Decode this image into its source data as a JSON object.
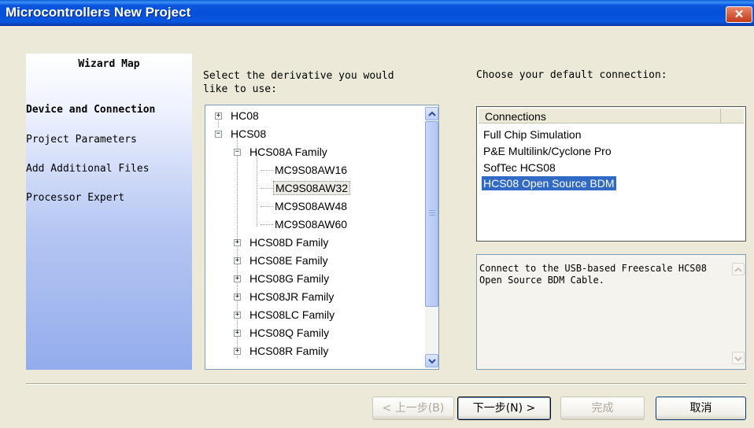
{
  "window": {
    "title": "Microcontrollers New Project",
    "close_glyph": "✕"
  },
  "wizard_map": {
    "heading": "Wizard Map",
    "steps": [
      {
        "label": "Device and Connection",
        "current": true
      },
      {
        "label": "Project Parameters",
        "current": false
      },
      {
        "label": "Add Additional Files",
        "current": false
      },
      {
        "label": "Processor Expert",
        "current": false
      }
    ]
  },
  "derivative": {
    "prompt": "Select the derivative you would\nlike to use:",
    "tree": [
      {
        "label": "HC08",
        "expander": "+"
      },
      {
        "label": "HCS08",
        "expander": "−"
      },
      {
        "label": "HCS08A Family",
        "expander": "−"
      },
      {
        "label": "MC9S08AW16"
      },
      {
        "label": "MC9S08AW32",
        "selected": true
      },
      {
        "label": "MC9S08AW48"
      },
      {
        "label": "MC9S08AW60"
      },
      {
        "label": "HCS08D Family",
        "expander": "+"
      },
      {
        "label": "HCS08E Family",
        "expander": "+"
      },
      {
        "label": "HCS08G Family",
        "expander": "+"
      },
      {
        "label": "HCS08JR Family",
        "expander": "+"
      },
      {
        "label": "HCS08LC Family",
        "expander": "+"
      },
      {
        "label": "HCS08Q Family",
        "expander": "+"
      },
      {
        "label": "HCS08R Family",
        "expander": "+"
      }
    ]
  },
  "connection": {
    "prompt": "Choose your default connection:",
    "column_header": "Connections",
    "items": [
      {
        "label": "Full Chip Simulation",
        "selected": false
      },
      {
        "label": "P&E Multilink/Cyclone Pro",
        "selected": false
      },
      {
        "label": "SofTec HCS08",
        "selected": false
      },
      {
        "label": "HCS08 Open Source BDM",
        "selected": true
      }
    ],
    "description": "Connect to the USB-based Freescale HCS08 Open Source BDM Cable."
  },
  "buttons": {
    "back": "< 上一步(B)",
    "next": "下一步(N) >",
    "finish": "完成",
    "cancel": "取消"
  },
  "icons": {
    "close": "close-icon",
    "scroll_up": "scroll-up-arrow-icon",
    "scroll_down": "scroll-down-arrow-icon"
  },
  "colors": {
    "title_bar": "#0855dd",
    "selection": "#316ac5",
    "close_button": "#c4391a",
    "dialog_bg": "#ece9d8"
  }
}
